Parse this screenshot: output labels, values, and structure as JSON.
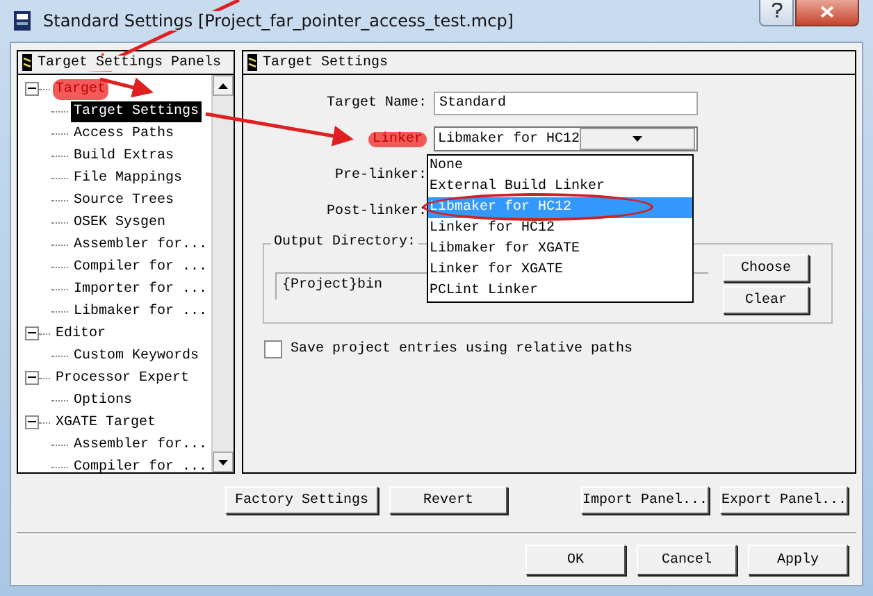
{
  "window": {
    "title": "Standard Settings [Project_far_pointer_access_test.mcp]"
  },
  "left_panel": {
    "title": "Target Settings Panels",
    "tree": [
      {
        "label": "Target",
        "expanded": true,
        "highlighted": true,
        "selected": false,
        "children": [
          {
            "label": "Target Settings",
            "selected": true
          },
          {
            "label": "Access Paths",
            "selected": false
          },
          {
            "label": "Build Extras",
            "selected": false
          },
          {
            "label": "File Mappings",
            "selected": false
          },
          {
            "label": "Source Trees",
            "selected": false
          },
          {
            "label": "OSEK Sysgen",
            "selected": false
          },
          {
            "label": "Assembler for...",
            "selected": false
          },
          {
            "label": "Compiler for ...",
            "selected": false
          },
          {
            "label": "Importer for ...",
            "selected": false
          },
          {
            "label": "Libmaker for ...",
            "selected": false
          }
        ]
      },
      {
        "label": "Editor",
        "expanded": true,
        "highlighted": false,
        "selected": false,
        "children": [
          {
            "label": "Custom Keywords",
            "selected": false
          }
        ]
      },
      {
        "label": "Processor Expert",
        "expanded": true,
        "highlighted": false,
        "selected": false,
        "children": [
          {
            "label": "Options",
            "selected": false
          }
        ]
      },
      {
        "label": "XGATE Target",
        "expanded": true,
        "highlighted": false,
        "selected": false,
        "children": [
          {
            "label": "Assembler for...",
            "selected": false
          },
          {
            "label": "Compiler for ...",
            "selected": false
          }
        ]
      }
    ]
  },
  "right_panel": {
    "title": "Target Settings",
    "target_name": {
      "label": "Target Name:",
      "value": "Standard"
    },
    "linker": {
      "label": "Linker",
      "highlighted": true,
      "value": "Libmaker for HC12",
      "options": [
        {
          "label": "None",
          "selected": false,
          "circled": false
        },
        {
          "label": "External Build Linker",
          "selected": false,
          "circled": false
        },
        {
          "label": "Libmaker for HC12",
          "selected": true,
          "circled": true
        },
        {
          "label": "Linker for HC12",
          "selected": false,
          "circled": false
        },
        {
          "label": "Libmaker for XGATE",
          "selected": false,
          "circled": false
        },
        {
          "label": "Linker for XGATE",
          "selected": false,
          "circled": false
        },
        {
          "label": "PCLint Linker",
          "selected": false,
          "circled": false
        }
      ]
    },
    "pre_linker": {
      "label": "Pre-linker:"
    },
    "post_linker": {
      "label": "Post-linker:"
    },
    "output_directory": {
      "label": "Output Directory:",
      "value": "{Project}bin",
      "buttons": [
        "Choose",
        "Clear"
      ]
    },
    "save_relative": {
      "label": "Save project entries using relative paths",
      "checked": false
    }
  },
  "panel_buttons": [
    "Factory Settings",
    "Revert",
    "Import Panel...",
    "Export Panel..."
  ],
  "dialog_buttons": [
    "OK",
    "Cancel",
    "Apply"
  ]
}
